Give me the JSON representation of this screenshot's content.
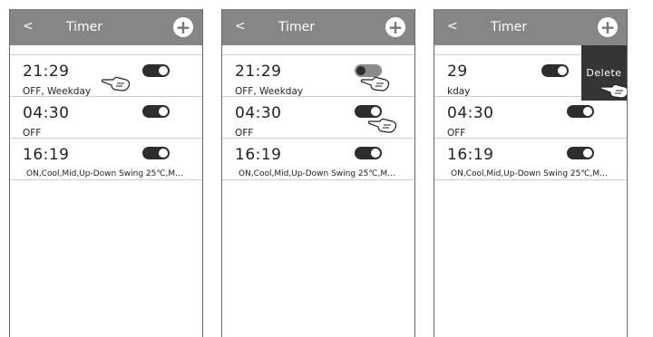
{
  "screens": [
    {
      "header": {
        "back": "<",
        "title": "Timer",
        "add": "+"
      },
      "timers": [
        {
          "time": "21:29",
          "desc": "OFF, Weekday",
          "state": "on"
        },
        {
          "time": "04:30",
          "desc": "OFF",
          "state": "on"
        },
        {
          "time": "16:19",
          "desc": "ON,Cool,Mid,Up-Down Swing 25℃,M...",
          "state": "on"
        }
      ]
    },
    {
      "header": {
        "back": "<",
        "title": "Timer",
        "add": "+"
      },
      "timers": [
        {
          "time": "21:29",
          "desc": "OFF, Weekday",
          "state": "pressed"
        },
        {
          "time": "04:30",
          "desc": "OFF",
          "state": "on"
        },
        {
          "time": "16:19",
          "desc": "ON,Cool,Mid,Up-Down Swing 25℃,M...",
          "state": "on"
        }
      ]
    },
    {
      "header": {
        "back": "<",
        "title": "Timer",
        "add": "+"
      },
      "timers": [
        {
          "time": "29",
          "desc": "kday",
          "state": "on"
        },
        {
          "time": "04:30",
          "desc": "OFF",
          "state": "on"
        },
        {
          "time": "16:19",
          "desc": "ON,Cool,Mid,Up-Down Swing 25℃,M...",
          "state": "on"
        }
      ],
      "delete_label": "Delete"
    }
  ],
  "icons": {
    "hand": "hand-pointer-icon",
    "add": "plus-icon",
    "back": "back-chevron-icon"
  },
  "colors": {
    "header": "#868686",
    "toggle_on": "#2d2d2d",
    "toggle_pressed": "#8a8a8a",
    "delete_bg": "#353535"
  }
}
